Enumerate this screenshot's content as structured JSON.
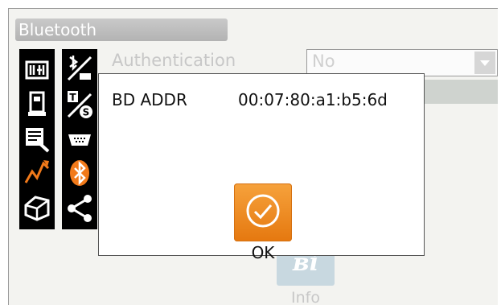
{
  "window": {
    "title": "Bluetooth"
  },
  "settings": {
    "authentication_label": "Authentication",
    "authentication_value": "No"
  },
  "side_icons": {
    "column1": [
      "instrument-icon",
      "survey-device-icon",
      "document-edit-icon",
      "graph-icon",
      "toolbox-icon"
    ],
    "column2": [
      "bluetooth-com-icon",
      "toggle-ts-icon",
      "serial-port-icon",
      "bluetooth-icon",
      "share-icon"
    ],
    "accent_color": "#f27a1a"
  },
  "info": {
    "label": "Info",
    "icon_text": "ʙi"
  },
  "dialog": {
    "bd_addr_label": "BD ADDR",
    "bd_addr_value": "00:07:80:a1:b5:6d",
    "ok_label": "OK",
    "ok_color": "#f08c22"
  }
}
